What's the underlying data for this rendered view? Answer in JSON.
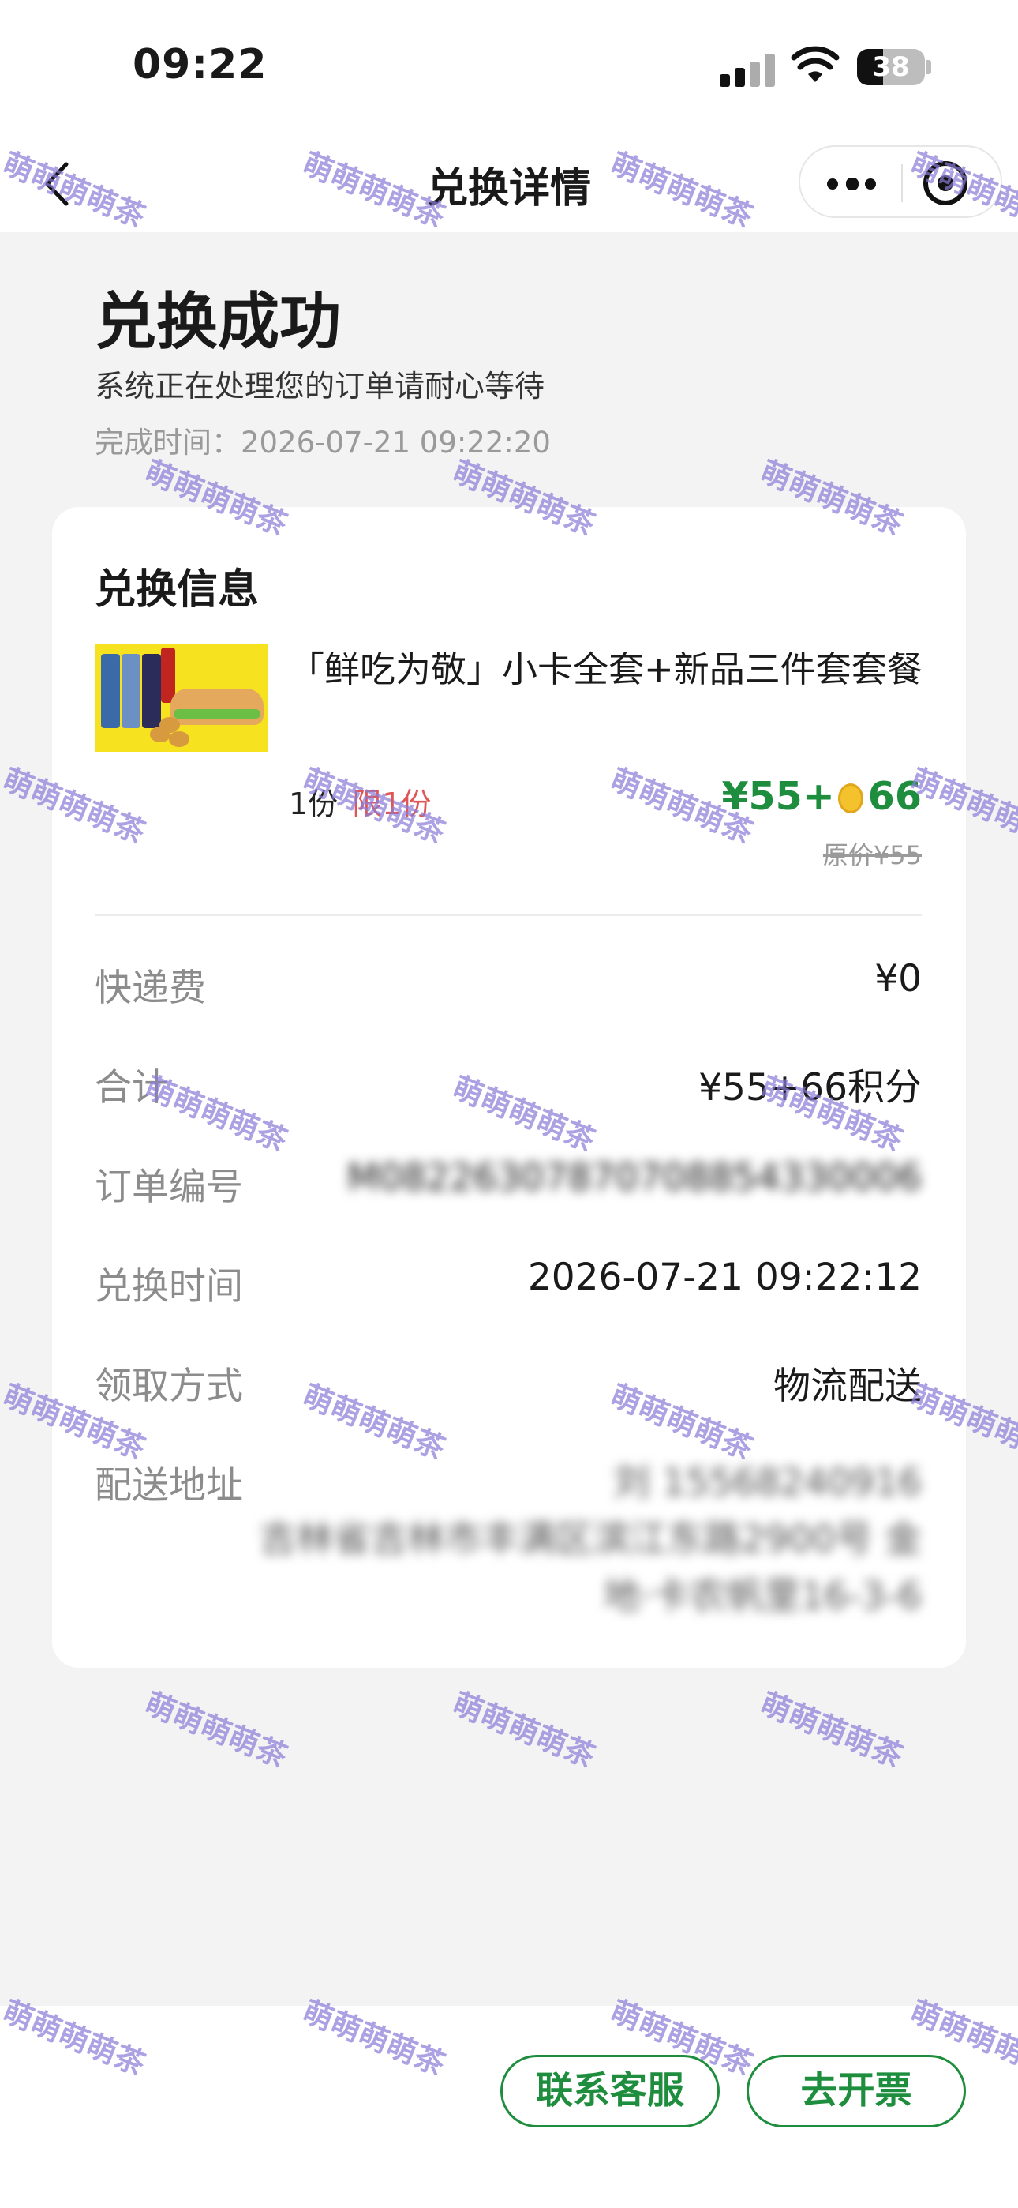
{
  "status_bar": {
    "time": "09:22",
    "battery": "38",
    "battery_level": 0.38
  },
  "nav": {
    "title": "兑换详情"
  },
  "header": {
    "title": "兑换成功",
    "subtitle": "系统正在处理您的订单请耐心等待",
    "completion_time": "完成时间：2026-07-21 09:22:20"
  },
  "card": {
    "title": "兑换信息",
    "product": {
      "name": "「鲜吃为敬」小卡全套+新品三件套套餐",
      "quantity": "1份",
      "limit": "限1份",
      "price_cash": "¥55+",
      "price_points": "66",
      "original_price": "原价¥55"
    },
    "rows": [
      {
        "label": "快递费",
        "value": "¥0"
      },
      {
        "label": "合计",
        "value": "¥55+66积分"
      },
      {
        "label": "订单编号",
        "value": "M08226307870708854330006"
      },
      {
        "label": "兑换时间",
        "value": "2026-07-21 09:22:12"
      },
      {
        "label": "领取方式",
        "value": "物流配送"
      }
    ],
    "address": {
      "label": "配送地址",
      "line1": "刘 15568240916",
      "line2": "吉林省吉林市丰满区滨江东路2900号 金",
      "line3": "地·卡农帆里16-3-6"
    }
  },
  "buttons": {
    "contact_service": "联系客服",
    "invoice": "去开票"
  },
  "watermark": {
    "text": "萌萌萌萌茶"
  },
  "colors": {
    "accent_green": "#1e8e3e",
    "limit_red": "#e05656",
    "background": "#f3f3f3",
    "watermark": "#8a7cd8"
  }
}
